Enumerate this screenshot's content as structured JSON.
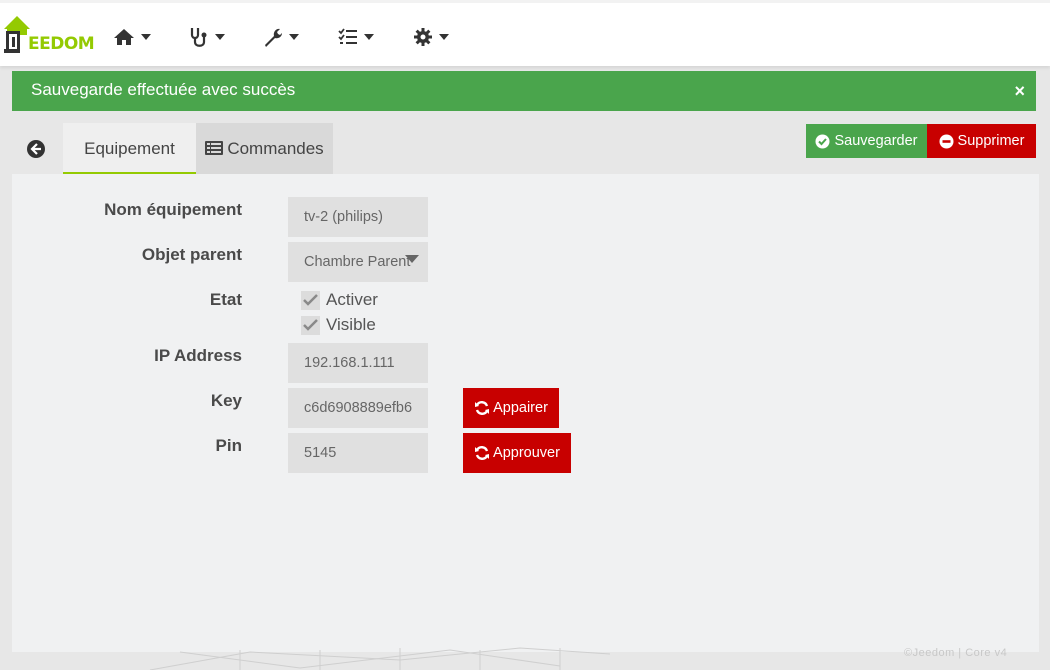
{
  "app": {
    "logo_text": "EEDOM",
    "brand_color": "#94ca02"
  },
  "navbar": {
    "items": [
      {
        "icon": "home-icon"
      },
      {
        "icon": "stethoscope-icon"
      },
      {
        "icon": "wrench-icon"
      },
      {
        "icon": "tasks-icon"
      },
      {
        "icon": "gear-icon"
      }
    ]
  },
  "alert": {
    "message": "Sauvegarde effectuée avec succès",
    "close": "×",
    "color": "#4aa54c"
  },
  "tabs": {
    "equipment": "Equipement",
    "commands": "Commandes"
  },
  "actions": {
    "save": "Sauvegarder",
    "delete": "Supprimer",
    "save_color": "#4aa54c",
    "delete_color": "#c80000"
  },
  "form": {
    "name_label": "Nom équipement",
    "name_value": "tv-2 (philips)",
    "parent_label": "Objet parent",
    "parent_value": "Chambre Parent",
    "state_label": "Etat",
    "activate_label": "Activer",
    "visible_label": "Visible",
    "ip_label": "IP Address",
    "ip_value": "192.168.1.111",
    "key_label": "Key",
    "key_value": "c6d6908889efb6",
    "pin_label": "Pin",
    "pin_value": "5145",
    "pair_button": "Appairer",
    "approve_button": "Approuver"
  },
  "footer": {
    "text": "©Jeedom | Core v4"
  }
}
